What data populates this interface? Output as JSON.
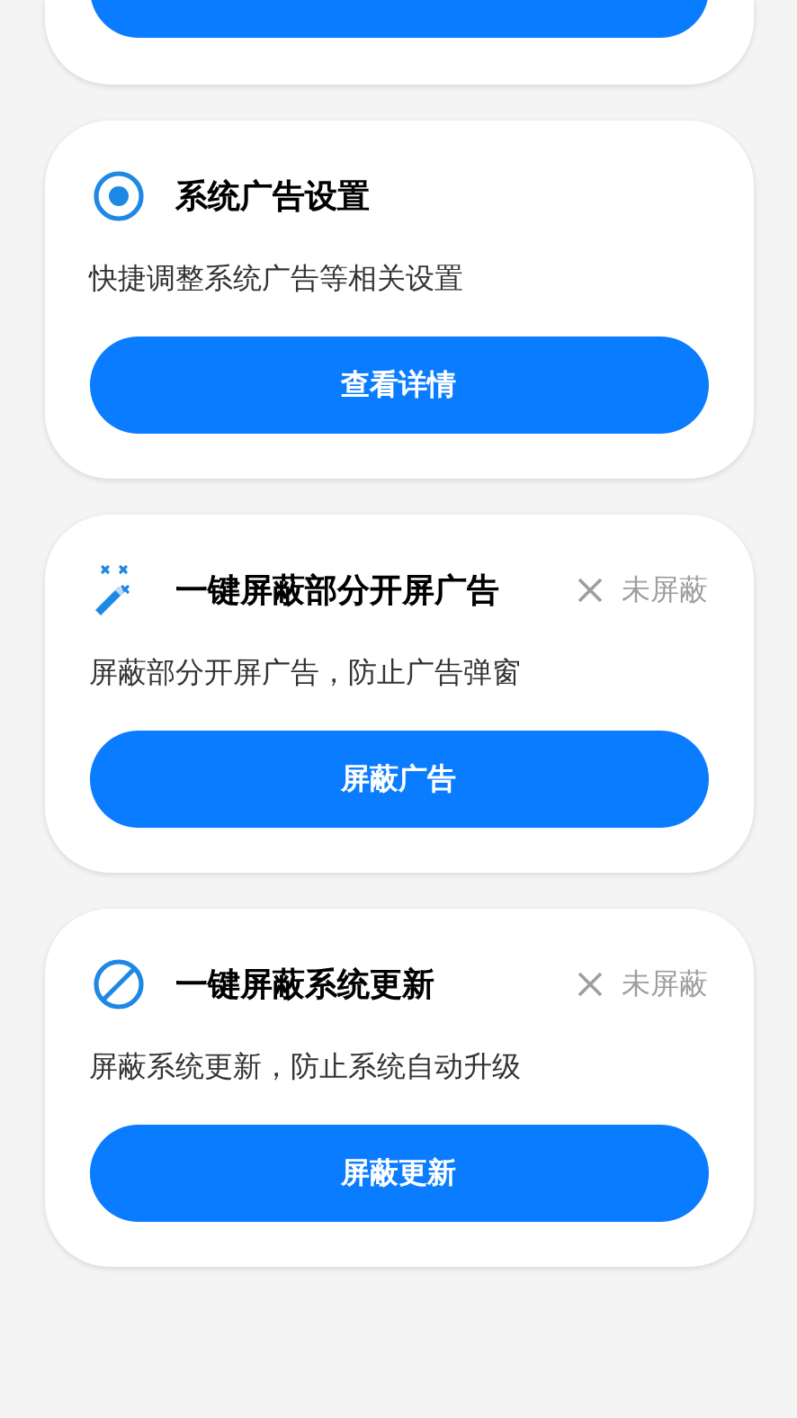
{
  "cards": [
    {
      "title": "系统广告设置",
      "description": "快捷调整系统广告等相关设置",
      "button": "查看详情"
    },
    {
      "title": "一键屏蔽部分开屏广告",
      "status": {
        "blocked": false,
        "label": "未屏蔽"
      },
      "description": "屏蔽部分开屏广告，防止广告弹窗",
      "button": "屏蔽广告"
    },
    {
      "title": "一键屏蔽系统更新",
      "status": {
        "blocked": false,
        "label": "未屏蔽"
      },
      "description": "屏蔽系统更新，防止系统自动升级",
      "button": "屏蔽更新"
    }
  ]
}
